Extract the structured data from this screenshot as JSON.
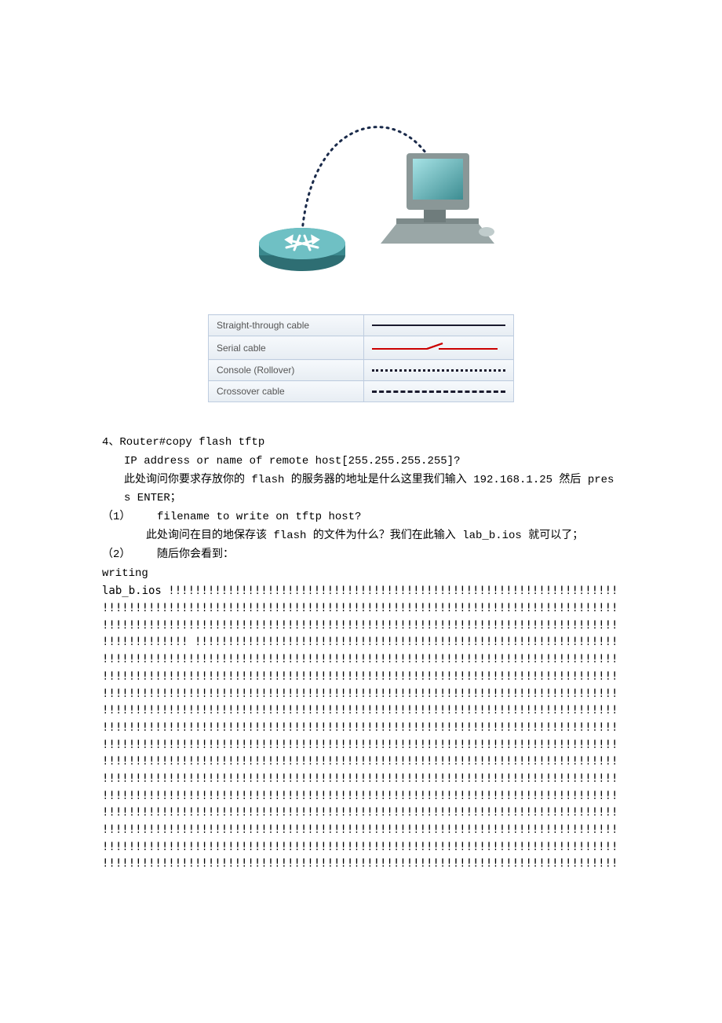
{
  "legend": {
    "rows": [
      {
        "label": "Straight-through cable"
      },
      {
        "label": "Serial cable"
      },
      {
        "label": "Console (Rollover)"
      },
      {
        "label": "Crossover cable"
      }
    ]
  },
  "step4": {
    "heading": "4、Router#copy flash tftp",
    "line1": "IP address or name of remote host[255.255.255.255]?",
    "line2": "此处询问你要求存放你的 flash 的服务器的地址是什么这里我们输入 192.168.1.25 然后 press ENTER；",
    "sub1_label": "（1）",
    "sub1_text": "filename to write on tftp host?",
    "sub1_note": "此处询问在目的地保存该 flash 的文件为什么？我们在此输入 lab_b.ios 就可以了；",
    "sub2_label": "（2）",
    "sub2_text": "随后你会看到：",
    "writing": "writing",
    "first_bang": "lab_b.ios !!!!!!!!!!!!!!!!!!!!!!!!!!!!!!!!!!!!!!!!!!!!!!!!!!!!!!!!!!!!!!!!!!!!",
    "bang_row": "!!!!!!!!!!!!!!!!!!!!!!!!!!!!!!!!!!!!!!!!!!!!!!!!!!!!!!!!!!!!!!!!!!!!!!!!!!!!!!",
    "bang_row_gap": "!!!!!!!!!!!!! !!!!!!!!!!!!!!!!!!!!!!!!!!!!!!!!!!!!!!!!!!!!!!!!!!!!!!!!!!!!!!!!"
  }
}
